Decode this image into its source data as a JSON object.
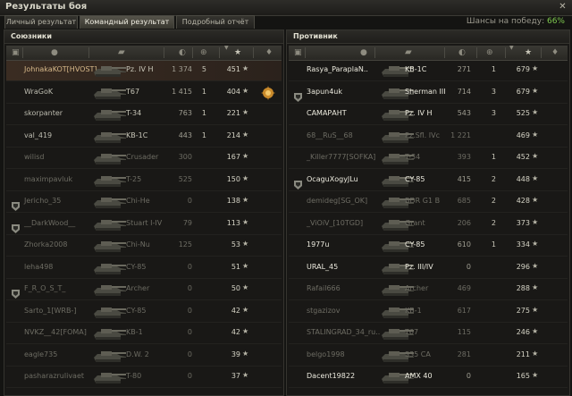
{
  "window": {
    "title": "Результаты боя"
  },
  "tabs": [
    {
      "label": "Личный результат",
      "active": false
    },
    {
      "label": "Командный результат",
      "active": true
    },
    {
      "label": "Подробный отчёт",
      "active": false
    }
  ],
  "win_chance": {
    "label": "Шансы на победу:",
    "value": "66%"
  },
  "allies": {
    "title": "Союзники",
    "rows": [
      {
        "name": "JohnakaKOT[HVOST]",
        "vehicle": "Pz. IV H",
        "damage": "1 374",
        "kills": "5",
        "xp": "451",
        "me": true,
        "dead": false,
        "squad": false,
        "medal": false
      },
      {
        "name": "WraGoK",
        "vehicle": "T67",
        "damage": "1 415",
        "kills": "1",
        "xp": "404",
        "me": false,
        "dead": false,
        "squad": false,
        "medal": true
      },
      {
        "name": "skorpanter",
        "vehicle": "T-34",
        "damage": "763",
        "kills": "1",
        "xp": "221",
        "me": false,
        "dead": false,
        "squad": false,
        "medal": false
      },
      {
        "name": "val_419",
        "vehicle": "KB-1C",
        "damage": "443",
        "kills": "1",
        "xp": "214",
        "me": false,
        "dead": false,
        "squad": false,
        "medal": false
      },
      {
        "name": "wilisd",
        "vehicle": "Crusader",
        "damage": "300",
        "kills": "",
        "xp": "167",
        "me": false,
        "dead": true,
        "squad": false,
        "medal": false
      },
      {
        "name": "maximpavluk",
        "vehicle": "T-25",
        "damage": "525",
        "kills": "",
        "xp": "150",
        "me": false,
        "dead": true,
        "squad": false,
        "medal": false
      },
      {
        "name": "Jericho_35",
        "vehicle": "Chi-He",
        "damage": "0",
        "kills": "",
        "xp": "138",
        "me": false,
        "dead": true,
        "squad": true,
        "medal": false
      },
      {
        "name": "__DarkWood__",
        "vehicle": "Stuart I-IV",
        "damage": "79",
        "kills": "",
        "xp": "113",
        "me": false,
        "dead": true,
        "squad": true,
        "medal": false
      },
      {
        "name": "Zhorka2008",
        "vehicle": "Chi-Nu",
        "damage": "125",
        "kills": "",
        "xp": "53",
        "me": false,
        "dead": true,
        "squad": false,
        "medal": false
      },
      {
        "name": "leha498",
        "vehicle": "CY-85",
        "damage": "0",
        "kills": "",
        "xp": "51",
        "me": false,
        "dead": true,
        "squad": false,
        "medal": false
      },
      {
        "name": "F_R_O_S_T_",
        "vehicle": "Archer",
        "damage": "0",
        "kills": "",
        "xp": "50",
        "me": false,
        "dead": true,
        "squad": true,
        "medal": false
      },
      {
        "name": "Sarto_1[WRB-]",
        "vehicle": "CY-85",
        "damage": "0",
        "kills": "",
        "xp": "42",
        "me": false,
        "dead": true,
        "squad": false,
        "medal": false
      },
      {
        "name": "NVKZ__42[FOMA]",
        "vehicle": "KB-1",
        "damage": "0",
        "kills": "",
        "xp": "42",
        "me": false,
        "dead": true,
        "squad": false,
        "medal": false
      },
      {
        "name": "eagle735",
        "vehicle": "D.W. 2",
        "damage": "0",
        "kills": "",
        "xp": "39",
        "me": false,
        "dead": true,
        "squad": false,
        "medal": false
      },
      {
        "name": "pasharazrulivaet",
        "vehicle": "T-80",
        "damage": "0",
        "kills": "",
        "xp": "37",
        "me": false,
        "dead": true,
        "squad": false,
        "medal": false
      }
    ]
  },
  "enemies": {
    "title": "Противник",
    "rows": [
      {
        "name": "Rasya_ParaplaN..",
        "vehicle": "KB-1C",
        "damage": "271",
        "kills": "1",
        "xp": "679",
        "dead": false,
        "squad": false,
        "bright": true
      },
      {
        "name": "3apun4uk",
        "vehicle": "Sherman III",
        "damage": "714",
        "kills": "3",
        "xp": "679",
        "dead": false,
        "squad": true,
        "bright": true
      },
      {
        "name": "САМАРАНТ",
        "vehicle": "Pz. IV H",
        "damage": "543",
        "kills": "3",
        "xp": "525",
        "dead": false,
        "squad": false,
        "bright": true
      },
      {
        "name": "68__RuS__68",
        "vehicle": "Pz.Sfl. IVc",
        "damage": "1 221",
        "kills": "",
        "xp": "469",
        "dead": true,
        "squad": false,
        "bright": false
      },
      {
        "name": "_Killer7777[SOFKA]",
        "vehicle": "T-34",
        "damage": "393",
        "kills": "1",
        "xp": "452",
        "dead": true,
        "squad": false,
        "bright": false
      },
      {
        "name": "OcaguXogyJLu",
        "vehicle": "CY-85",
        "damage": "415",
        "kills": "2",
        "xp": "448",
        "dead": false,
        "squad": true,
        "bright": true
      },
      {
        "name": "demideg[SG_OK]",
        "vehicle": "BDR G1 B",
        "damage": "685",
        "kills": "2",
        "xp": "428",
        "dead": true,
        "squad": false,
        "bright": false
      },
      {
        "name": "_ViOiV_[10TGD]",
        "vehicle": "Grant",
        "damage": "206",
        "kills": "2",
        "xp": "373",
        "dead": true,
        "squad": false,
        "bright": false
      },
      {
        "name": "1977u",
        "vehicle": "CY-85",
        "damage": "610",
        "kills": "1",
        "xp": "334",
        "dead": false,
        "squad": false,
        "bright": true
      },
      {
        "name": "URAL_45",
        "vehicle": "Pz. III/IV",
        "damage": "0",
        "kills": "",
        "xp": "296",
        "dead": false,
        "squad": false,
        "bright": true
      },
      {
        "name": "Rafail666",
        "vehicle": "Archer",
        "damage": "469",
        "kills": "",
        "xp": "288",
        "dead": true,
        "squad": false,
        "bright": false
      },
      {
        "name": "stgazizov",
        "vehicle": "KB-1",
        "damage": "617",
        "kills": "",
        "xp": "275",
        "dead": true,
        "squad": false,
        "bright": false
      },
      {
        "name": "STALINGRAD_34_ru..",
        "vehicle": "T67",
        "damage": "115",
        "kills": "",
        "xp": "246",
        "dead": true,
        "squad": false,
        "bright": false
      },
      {
        "name": "belgo1998",
        "vehicle": "S35 CA",
        "damage": "281",
        "kills": "",
        "xp": "211",
        "dead": true,
        "squad": false,
        "bright": false
      },
      {
        "name": "Dacent19822",
        "vehicle": "AMX 40",
        "damage": "0",
        "kills": "",
        "xp": "165",
        "dead": false,
        "squad": false,
        "bright": true
      }
    ]
  },
  "header_icons": [
    "squad-icon",
    "player-icon",
    "vehicle-icon",
    "damage-icon",
    "kills-icon",
    "xp-star-icon",
    "medal-icon"
  ],
  "colors": {
    "win_chance": "#7fc94f",
    "me_row": "#3a2c22"
  }
}
